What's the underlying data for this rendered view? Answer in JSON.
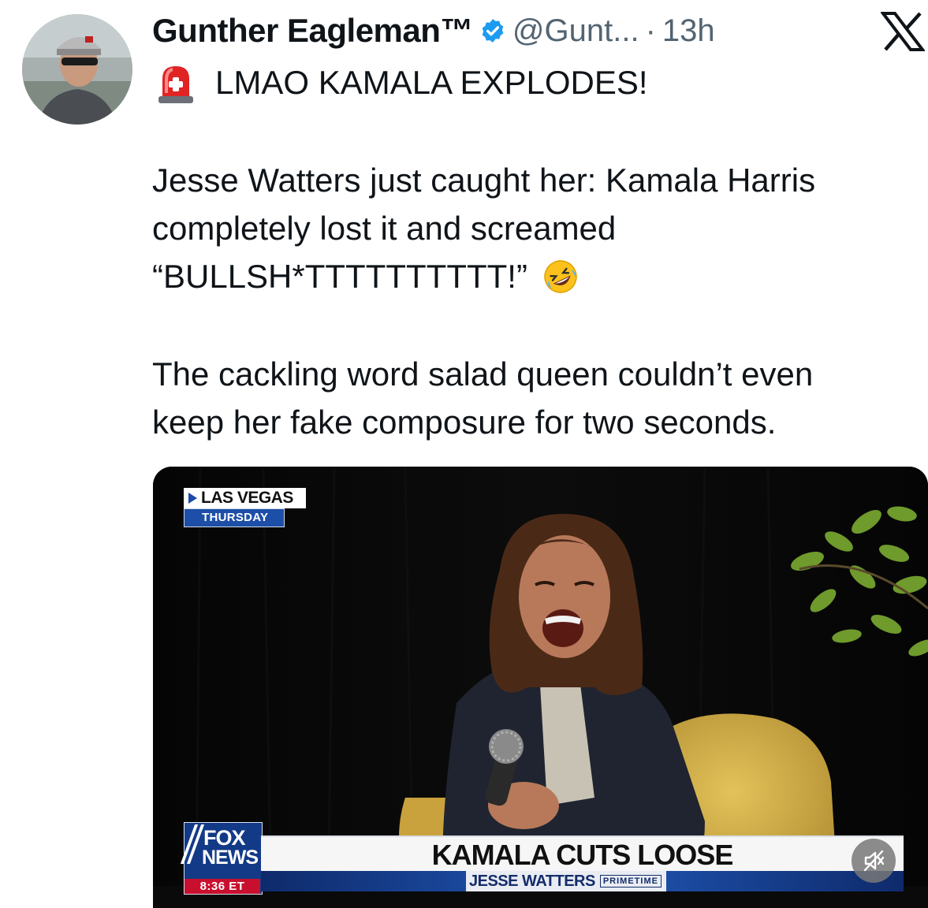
{
  "tweet": {
    "author": {
      "display_name": "Gunther Eagleman™",
      "handle": "@Gunt...",
      "separator": "·",
      "time": "13h"
    },
    "headline": "LMAO KAMALA EXPLODES!",
    "paragraph1": [
      "Jesse Watters just caught her: Kamala Harris",
      "completely lost it and screamed",
      "“BULLSH*TTTTTTTTTT!”"
    ],
    "paragraph2": [
      "The cackling word salad queen couldn’t even",
      "keep her fake composure for two seconds."
    ]
  },
  "video": {
    "location": "LAS VEGAS",
    "day": "THURSDAY",
    "logo_line1": "FOX",
    "logo_line2": "NEWS",
    "clock": "8:36 ET",
    "chyron_title": "KAMALA CUTS LOOSE",
    "chyron_show": "JESSE WATTERS",
    "chyron_tag": "PRIMETIME"
  },
  "icons": {
    "verified": "verified-badge-icon",
    "platform": "x-logo-icon",
    "headline_emoji": "siren-icon",
    "reaction_emoji": "rofl-emoji-icon",
    "mute": "mute-icon"
  },
  "colors": {
    "verified_blue": "#1d9bf0",
    "secondary_text": "#536471",
    "fox_blue": "#1d4fa8",
    "fox_red": "#c8102e"
  }
}
